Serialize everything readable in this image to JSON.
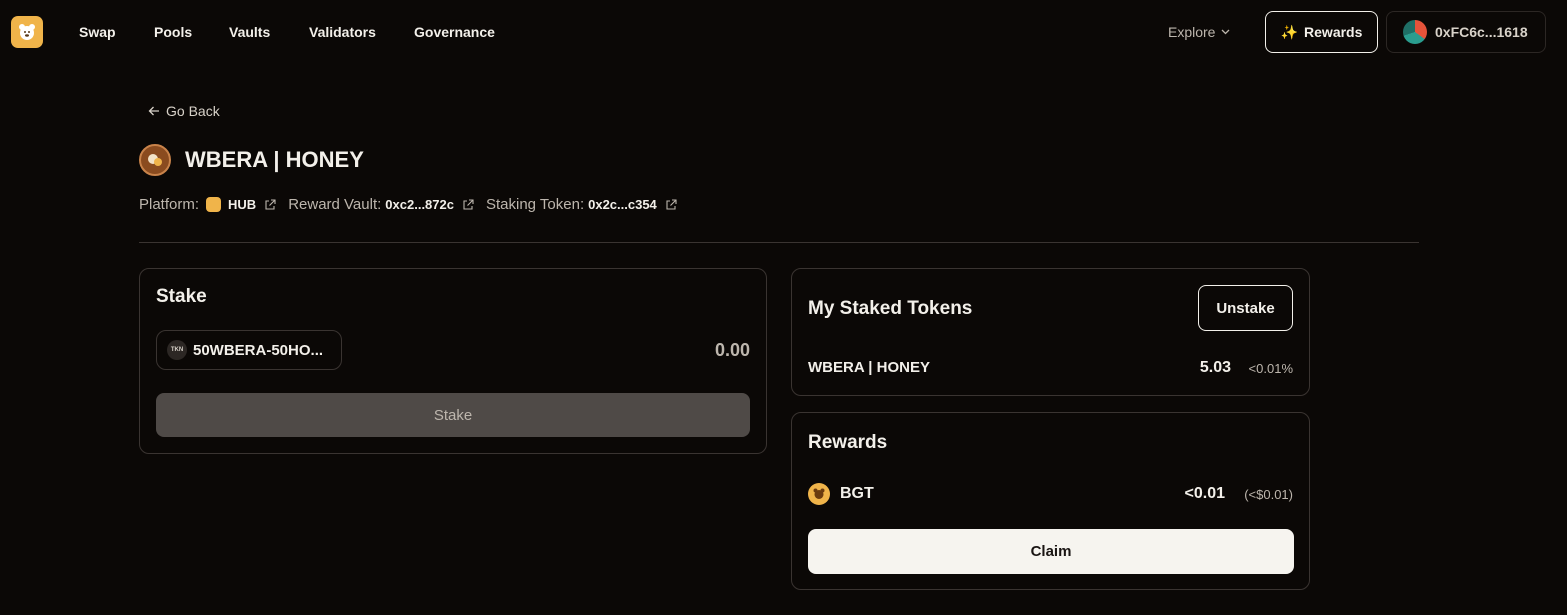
{
  "nav": {
    "links": [
      "Swap",
      "Pools",
      "Vaults",
      "Validators",
      "Governance"
    ],
    "explore_label": "Explore",
    "rewards_label": "Rewards",
    "wallet_address": "0xFC6c...1618"
  },
  "header": {
    "go_back_label": "Go Back",
    "title": "WBERA | HONEY",
    "platform_label": "Platform:",
    "platform_value": "HUB",
    "reward_vault_label": "Reward Vault:",
    "reward_vault_value": "0xc2...872c",
    "staking_token_label": "Staking Token:",
    "staking_token_value": "0x2c...c354"
  },
  "stake_card": {
    "title": "Stake",
    "token_icon_text": "TKN",
    "token_name": "50WBERA-50HO...",
    "amount": "0.00",
    "button_label": "Stake"
  },
  "my_staked": {
    "title": "My Staked Tokens",
    "unstake_label": "Unstake",
    "token_label": "WBERA | HONEY",
    "amount": "5.03",
    "share": "<0.01%"
  },
  "rewards_card": {
    "title": "Rewards",
    "token_label": "BGT",
    "amount": "<0.01",
    "usd": "(<$0.01)",
    "claim_label": "Claim"
  },
  "colors": {
    "background": "#0b0806",
    "accent": "#f0b44a",
    "border": "#3a3431"
  }
}
